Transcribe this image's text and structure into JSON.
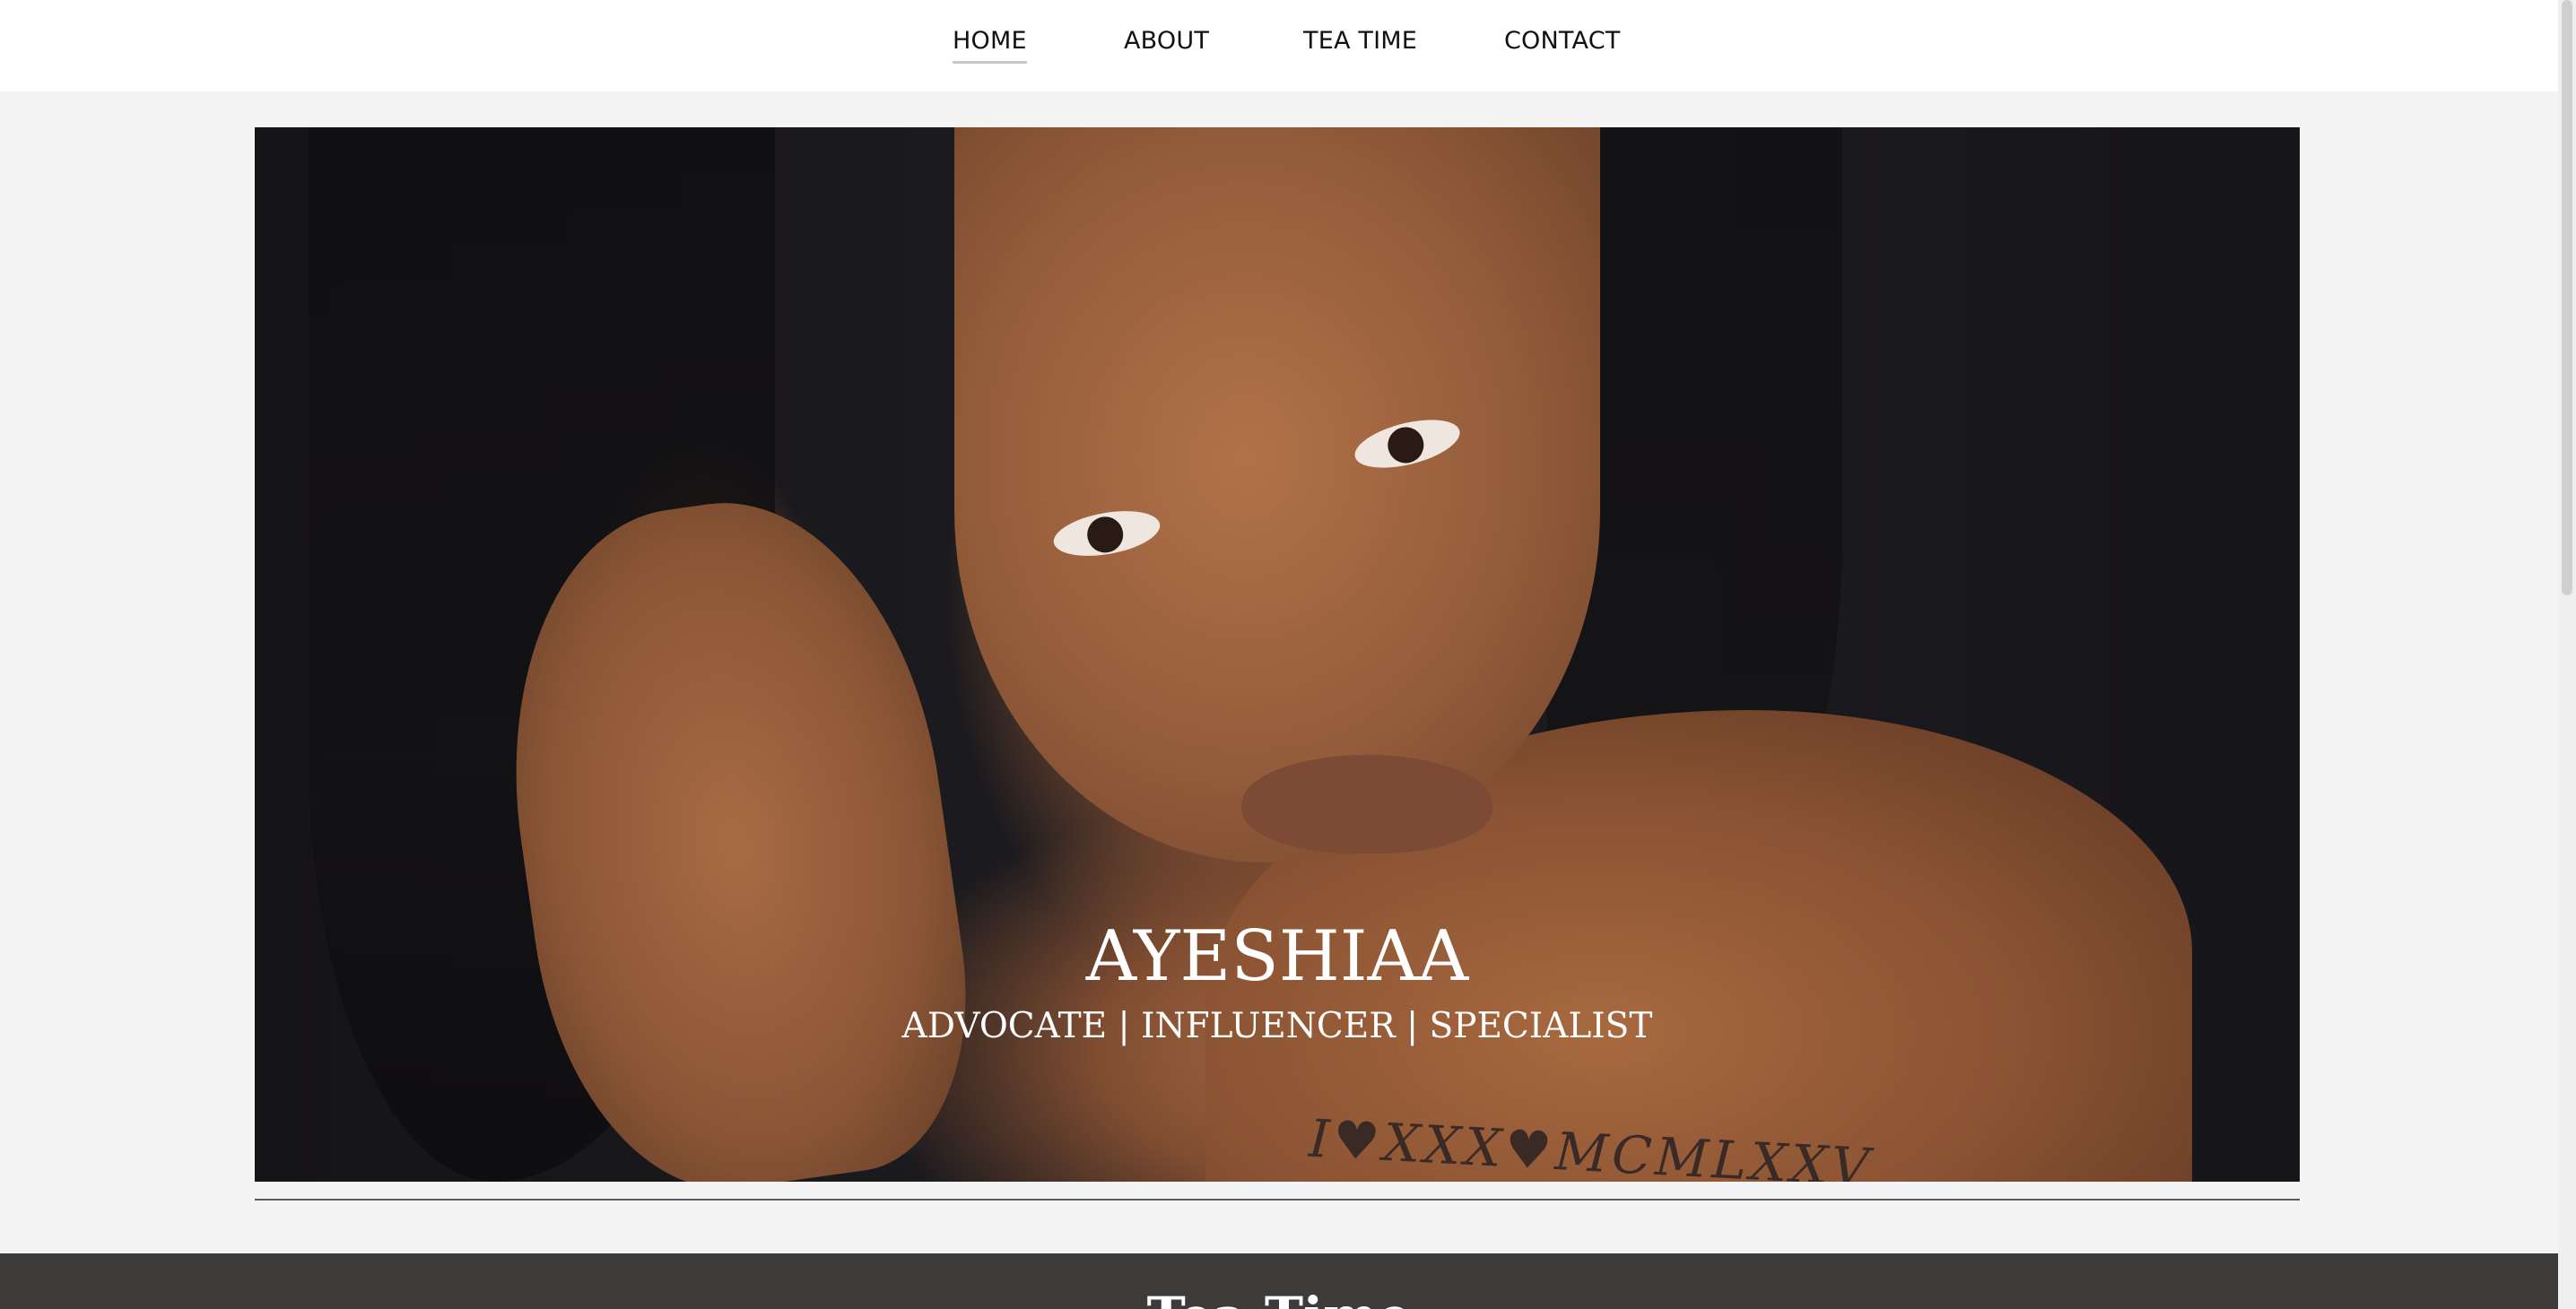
{
  "nav": {
    "items": [
      {
        "label": "HOME",
        "active": true
      },
      {
        "label": "ABOUT",
        "active": false
      },
      {
        "label": "TEA TIME",
        "active": false
      },
      {
        "label": "CONTACT",
        "active": false
      }
    ]
  },
  "hero": {
    "image": "portrait-photo",
    "tattoo_text": "I♥XXX♥MCMLXXV",
    "title": "AYESHIAA",
    "subtitle": "ADVOCATE | INFLUENCER | SPECIALIST"
  },
  "section": {
    "title": "Tea Time"
  },
  "colors": {
    "nav_bg": "#ffffff",
    "page_bg": "#f4f4f4",
    "dark_section_bg": "#3d3a3a",
    "text_light": "#ffffff"
  }
}
